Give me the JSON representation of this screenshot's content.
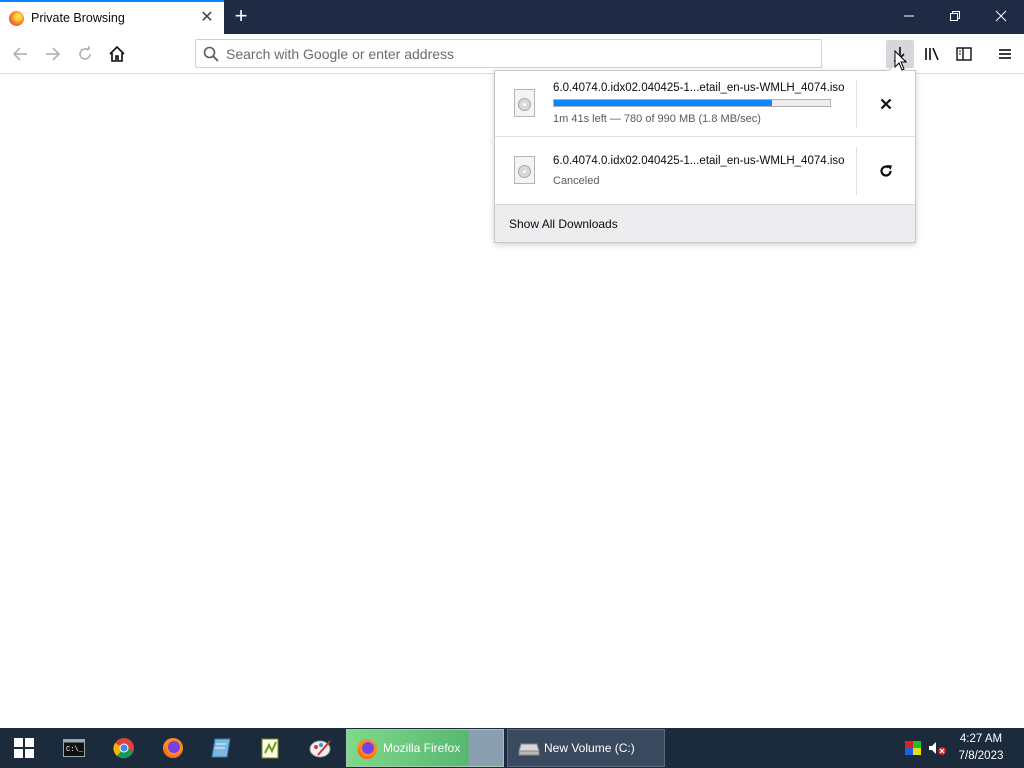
{
  "browser": {
    "tab_title": "Private Browsing",
    "tab_close": "✕",
    "new_tab": "+",
    "window_controls": {
      "minimize": "—",
      "restore": "❐",
      "close": "✕"
    }
  },
  "navbar": {
    "url_placeholder": "Search with Google or enter address",
    "back_icon": "arrow-left-icon",
    "forward_icon": "arrow-right-icon",
    "reload_icon": "reload-icon",
    "home_icon": "home-icon",
    "downloads_icon": "download-arrow-icon",
    "library_icon": "library-icon",
    "sidebar_icon": "sidebar-icon",
    "menu_icon": "hamburger-menu-icon"
  },
  "downloads_panel": {
    "items": [
      {
        "filename": "6.0.4074.0.idx02.040425-1...etail_en-us-WMLH_4074.iso",
        "status": "1m 41s left — 780 of 990 MB (1.8 MB/sec)",
        "progress": 0.79,
        "action": "✕",
        "action_icon": "cancel-icon"
      },
      {
        "filename": "6.0.4074.0.idx02.040425-1...etail_en-us-WMLH_4074.iso",
        "status": "Canceled",
        "action": "↻",
        "action_icon": "retry-icon"
      }
    ],
    "footer": "Show All Downloads"
  },
  "taskbar": {
    "pinned": [
      "start-icon",
      "terminal-icon",
      "chrome-icon",
      "firefox-icon",
      "notepad-icon",
      "notepad-plus-icon",
      "paint-icon"
    ],
    "apps": [
      {
        "label": "Mozilla Firefox",
        "icon": "firefox-icon"
      },
      {
        "label": "New Volume (C:)",
        "icon": "drive-icon"
      }
    ],
    "clock_time": "4:27 AM",
    "clock_date": "7/8/2023"
  }
}
